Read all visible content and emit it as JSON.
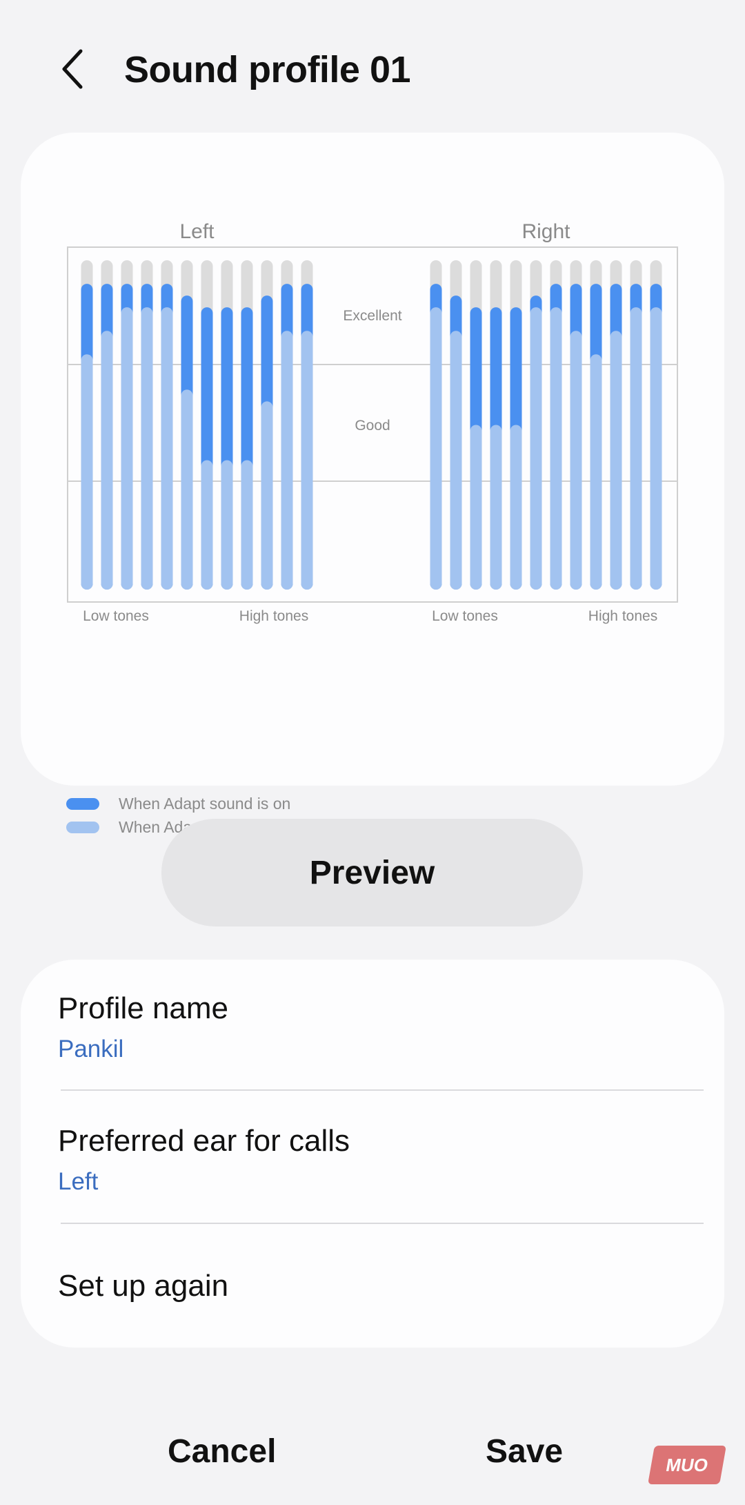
{
  "header": {
    "title": "Sound profile 01"
  },
  "chart_data": {
    "type": "bar",
    "panels": [
      {
        "name": "Left",
        "x_start_label": "Low tones",
        "x_end_label": "High tones",
        "series": [
          {
            "name": "When Adapt sound is on",
            "values": [
              2.6,
              2.6,
              2.6,
              2.6,
              2.6,
              2.5,
              2.4,
              2.4,
              2.4,
              2.5,
              2.6,
              2.6
            ]
          },
          {
            "name": "When Adapt sound is off",
            "values": [
              2.0,
              2.2,
              2.4,
              2.4,
              2.4,
              1.7,
              1.1,
              1.1,
              1.1,
              1.6,
              2.2,
              2.2
            ]
          }
        ]
      },
      {
        "name": "Right",
        "x_start_label": "Low tones",
        "x_end_label": "High tones",
        "series": [
          {
            "name": "When Adapt sound is on",
            "values": [
              2.6,
              2.5,
              2.4,
              2.4,
              2.4,
              2.5,
              2.6,
              2.6,
              2.6,
              2.6,
              2.6,
              2.6
            ]
          },
          {
            "name": "When Adapt sound is off",
            "values": [
              2.4,
              2.2,
              1.4,
              1.4,
              1.4,
              2.4,
              2.4,
              2.2,
              2.0,
              2.2,
              2.4,
              2.4
            ]
          }
        ]
      }
    ],
    "band_labels": [
      "Excellent",
      "Good"
    ],
    "ylim": [
      0,
      2.8
    ],
    "colors": {
      "on": "#4a90f0",
      "off": "#a2c3f0",
      "track": "#dcdcdc"
    },
    "legend": [
      {
        "label": "When Adapt sound is on",
        "color": "#4a90f0"
      },
      {
        "label": "When Adapt sound is off",
        "color": "#a2c3f0"
      }
    ]
  },
  "preview_label": "Preview",
  "settings": [
    {
      "title": "Profile name",
      "value": "Pankil"
    },
    {
      "title": "Preferred ear for calls",
      "value": "Left"
    },
    {
      "title": "Set up again"
    }
  ],
  "footer": {
    "cancel": "Cancel",
    "save": "Save"
  },
  "watermark": "MUO"
}
